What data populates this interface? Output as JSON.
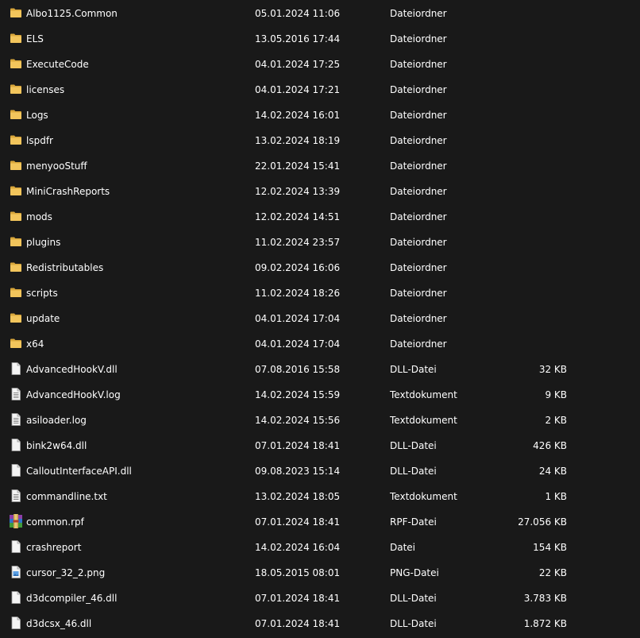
{
  "colors": {
    "background": "#191919",
    "text": "#ffffff",
    "folder": "#f2c55c",
    "folder_dark": "#d9a73b"
  },
  "files": [
    {
      "name": "Albo1125.Common",
      "modified": "05.01.2024 11:06",
      "type": "Dateiordner",
      "size": "",
      "icon": "folder-icon"
    },
    {
      "name": "ELS",
      "modified": "13.05.2016 17:44",
      "type": "Dateiordner",
      "size": "",
      "icon": "folder-icon"
    },
    {
      "name": "ExecuteCode",
      "modified": "04.01.2024 17:25",
      "type": "Dateiordner",
      "size": "",
      "icon": "folder-icon"
    },
    {
      "name": "licenses",
      "modified": "04.01.2024 17:21",
      "type": "Dateiordner",
      "size": "",
      "icon": "folder-icon"
    },
    {
      "name": "Logs",
      "modified": "14.02.2024 16:01",
      "type": "Dateiordner",
      "size": "",
      "icon": "folder-icon"
    },
    {
      "name": "lspdfr",
      "modified": "13.02.2024 18:19",
      "type": "Dateiordner",
      "size": "",
      "icon": "folder-icon"
    },
    {
      "name": "menyooStuff",
      "modified": "22.01.2024 15:41",
      "type": "Dateiordner",
      "size": "",
      "icon": "folder-icon"
    },
    {
      "name": "MiniCrashReports",
      "modified": "12.02.2024 13:39",
      "type": "Dateiordner",
      "size": "",
      "icon": "folder-icon"
    },
    {
      "name": "mods",
      "modified": "12.02.2024 14:51",
      "type": "Dateiordner",
      "size": "",
      "icon": "folder-icon"
    },
    {
      "name": "plugins",
      "modified": "11.02.2024 23:57",
      "type": "Dateiordner",
      "size": "",
      "icon": "folder-icon"
    },
    {
      "name": "Redistributables",
      "modified": "09.02.2024 16:06",
      "type": "Dateiordner",
      "size": "",
      "icon": "folder-icon"
    },
    {
      "name": "scripts",
      "modified": "11.02.2024 18:26",
      "type": "Dateiordner",
      "size": "",
      "icon": "folder-icon"
    },
    {
      "name": "update",
      "modified": "04.01.2024 17:04",
      "type": "Dateiordner",
      "size": "",
      "icon": "folder-icon"
    },
    {
      "name": "x64",
      "modified": "04.01.2024 17:04",
      "type": "Dateiordner",
      "size": "",
      "icon": "folder-icon"
    },
    {
      "name": "AdvancedHookV.dll",
      "modified": "07.08.2016 15:58",
      "type": "DLL-Datei",
      "size": "32 KB",
      "icon": "file-icon"
    },
    {
      "name": "AdvancedHookV.log",
      "modified": "14.02.2024 15:59",
      "type": "Textdokument",
      "size": "9 KB",
      "icon": "text-file-icon"
    },
    {
      "name": "asiloader.log",
      "modified": "14.02.2024 15:56",
      "type": "Textdokument",
      "size": "2 KB",
      "icon": "text-file-icon"
    },
    {
      "name": "bink2w64.dll",
      "modified": "07.01.2024 18:41",
      "type": "DLL-Datei",
      "size": "426 KB",
      "icon": "file-icon"
    },
    {
      "name": "CalloutInterfaceAPI.dll",
      "modified": "09.08.2023 15:14",
      "type": "DLL-Datei",
      "size": "24 KB",
      "icon": "file-icon"
    },
    {
      "name": "commandline.txt",
      "modified": "13.02.2024 18:05",
      "type": "Textdokument",
      "size": "1 KB",
      "icon": "text-file-icon"
    },
    {
      "name": "common.rpf",
      "modified": "07.01.2024 18:41",
      "type": "RPF-Datei",
      "size": "27.056 KB",
      "icon": "archive-icon"
    },
    {
      "name": "crashreport",
      "modified": "14.02.2024 16:04",
      "type": "Datei",
      "size": "154 KB",
      "icon": "file-icon"
    },
    {
      "name": "cursor_32_2.png",
      "modified": "18.05.2015 08:01",
      "type": "PNG-Datei",
      "size": "22 KB",
      "icon": "image-file-icon"
    },
    {
      "name": "d3dcompiler_46.dll",
      "modified": "07.01.2024 18:41",
      "type": "DLL-Datei",
      "size": "3.783 KB",
      "icon": "file-icon"
    },
    {
      "name": "d3dcsx_46.dll",
      "modified": "07.01.2024 18:41",
      "type": "DLL-Datei",
      "size": "1.872 KB",
      "icon": "file-icon"
    }
  ]
}
